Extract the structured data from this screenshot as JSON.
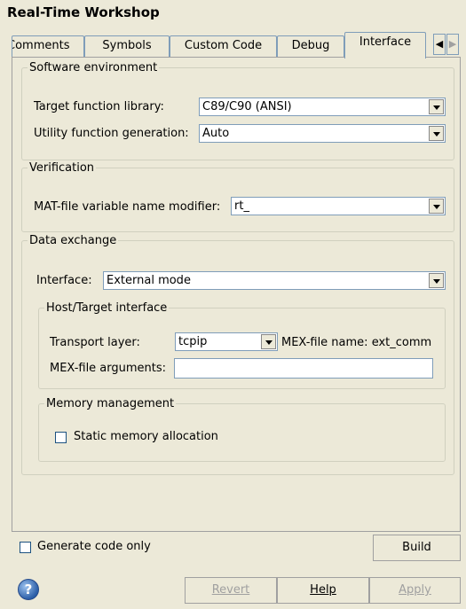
{
  "window": {
    "title": "Real-Time Workshop"
  },
  "tabs": [
    {
      "label": "Comments"
    },
    {
      "label": "Symbols"
    },
    {
      "label": "Custom Code"
    },
    {
      "label": "Debug"
    },
    {
      "label": "Interface",
      "active": true
    }
  ],
  "tab_scroll": {
    "left": "◀",
    "right": "▶"
  },
  "software_environment": {
    "legend": "Software environment",
    "target_function_library": {
      "label": "Target function library:",
      "value": "C89/C90 (ANSI)"
    },
    "utility_function_generation": {
      "label": "Utility function generation:",
      "value": "Auto"
    }
  },
  "verification": {
    "legend": "Verification",
    "mat_file_modifier": {
      "label": "MAT-file variable name modifier:",
      "value": "rt_"
    }
  },
  "data_exchange": {
    "legend": "Data exchange",
    "interface": {
      "label": "Interface:",
      "value": "External mode"
    },
    "host_target": {
      "legend": "Host/Target interface",
      "transport_layer": {
        "label": "Transport layer:",
        "value": "tcpip"
      },
      "mex_file_name": "MEX-file name: ext_comm",
      "mex_file_arguments": {
        "label": "MEX-file arguments:",
        "value": ""
      }
    },
    "memory_management": {
      "legend": "Memory management",
      "static_memory_allocation": {
        "label": "Static memory allocation",
        "checked": false
      }
    }
  },
  "footer": {
    "generate_code_only": {
      "label": "Generate code only",
      "checked": false
    },
    "build": "Build",
    "revert": "Revert",
    "help": "Help",
    "apply": "Apply",
    "help_icon_glyph": "?"
  }
}
